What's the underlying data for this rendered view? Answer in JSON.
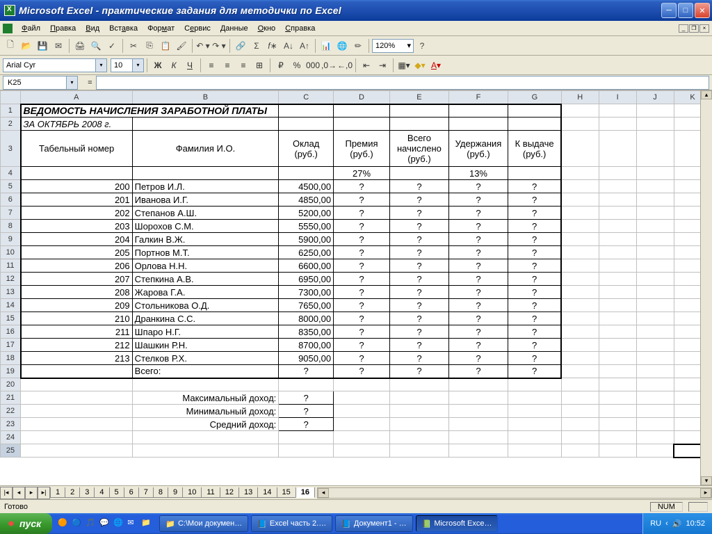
{
  "window": {
    "title": "Microsoft Excel - практические задания для методички по Excel"
  },
  "menu": {
    "file": "Файл",
    "edit": "Правка",
    "view": "Вид",
    "insert": "Вставка",
    "format": "Формат",
    "service": "Сервис",
    "data": "Данные",
    "window": "Окно",
    "help": "Справка"
  },
  "toolbar": {
    "zoom": "120%"
  },
  "format_bar": {
    "font": "Arial Cyr",
    "size": "10"
  },
  "namebox": "K25",
  "formula": "=",
  "columns": [
    "A",
    "B",
    "C",
    "D",
    "E",
    "F",
    "G",
    "H",
    "I",
    "J",
    "K"
  ],
  "widths": [
    100,
    176,
    76,
    78,
    82,
    82,
    74,
    52,
    52,
    52,
    52
  ],
  "headers": {
    "tabel": "Табельный номер",
    "fio": "Фамилия И.О.",
    "oklad": "Оклад (руб.)",
    "premia": "Премия (руб.)",
    "vsego": "Всего начислено (руб.)",
    "uderzh": "Удержания (руб.)",
    "kvidache": "К выдаче (руб.)"
  },
  "title_row": "ВЕДОМОСТЬ НАЧИСЛЕНИЯ ЗАРАБОТНОЙ ПЛАТЫ",
  "subtitle": "ЗА ОКТЯБРЬ 2008 г.",
  "premia_pct": "27%",
  "uderzh_pct": "13%",
  "data_rows": [
    {
      "n": "200",
      "name": "Петров И.Л.",
      "oklad": "4500,00"
    },
    {
      "n": "201",
      "name": "Иванова И.Г.",
      "oklad": "4850,00"
    },
    {
      "n": "202",
      "name": "Степанов А.Ш.",
      "oklad": "5200,00"
    },
    {
      "n": "203",
      "name": "Шорохов С.М.",
      "oklad": "5550,00"
    },
    {
      "n": "204",
      "name": "Галкин В.Ж.",
      "oklad": "5900,00"
    },
    {
      "n": "205",
      "name": "Портнов М.Т.",
      "oklad": "6250,00"
    },
    {
      "n": "206",
      "name": "Орлова Н.Н.",
      "oklad": "6600,00"
    },
    {
      "n": "207",
      "name": "Степкина А.В.",
      "oklad": "6950,00"
    },
    {
      "n": "208",
      "name": "Жарова Г.А.",
      "oklad": "7300,00"
    },
    {
      "n": "209",
      "name": "Стольникова О.Д.",
      "oklad": "7650,00"
    },
    {
      "n": "210",
      "name": "Дранкина С.С.",
      "oklad": "8000,00"
    },
    {
      "n": "211",
      "name": "Шпаро Н.Г.",
      "oklad": "8350,00"
    },
    {
      "n": "212",
      "name": "Шашкин Р.Н.",
      "oklad": "8700,00"
    },
    {
      "n": "213",
      "name": "Стелков Р.Х.",
      "oklad": "9050,00"
    }
  ],
  "total_label": "Всего:",
  "q": "?",
  "summary": {
    "max": "Максимальный доход:",
    "min": "Минимальный доход:",
    "avg": "Средний доход:"
  },
  "tabs": [
    "1",
    "2",
    "3",
    "4",
    "5",
    "6",
    "7",
    "8",
    "9",
    "10",
    "11",
    "12",
    "13",
    "14",
    "15",
    "16"
  ],
  "active_tab": "16",
  "status": "Готово",
  "num": "NUM",
  "taskbar": {
    "start": "пуск",
    "items": [
      "С:\\Мои докумен…",
      "Excel часть 2.…",
      "Документ1 - …",
      "Microsoft Exce…"
    ],
    "lang": "RU",
    "time": "10:52"
  }
}
